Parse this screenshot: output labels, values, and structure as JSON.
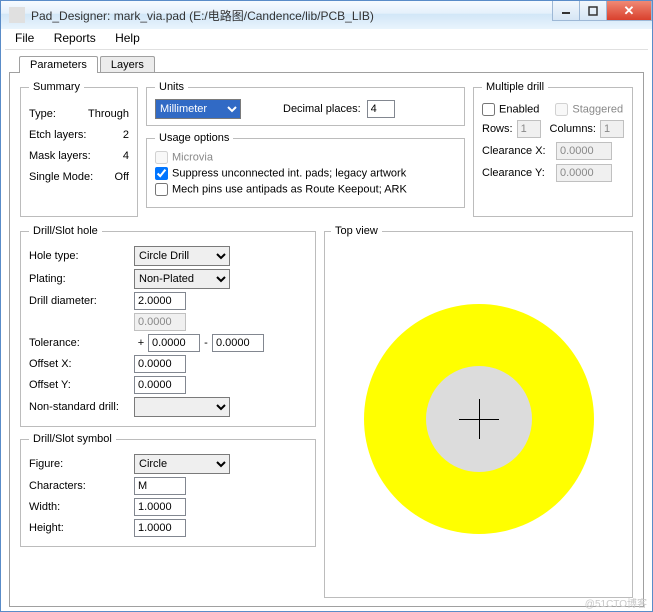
{
  "title": "Pad_Designer: mark_via.pad (E:/电路图/Candence/lib/PCB_LIB)",
  "menu": {
    "file": "File",
    "reports": "Reports",
    "help": "Help"
  },
  "tabs": {
    "parameters": "Parameters",
    "layers": "Layers"
  },
  "summary": {
    "legend": "Summary",
    "type_label": "Type:",
    "type_value": "Through",
    "etch_label": "Etch layers:",
    "etch_value": "2",
    "mask_label": "Mask layers:",
    "mask_value": "4",
    "single_label": "Single Mode:",
    "single_value": "Off"
  },
  "units": {
    "legend": "Units",
    "select_value": "Millimeter",
    "decimal_label": "Decimal places:",
    "decimal_value": "4"
  },
  "usage": {
    "legend": "Usage options",
    "microvia": "Microvia",
    "suppress": "Suppress unconnected int. pads; legacy artwork",
    "mechpins": "Mech pins use antipads as Route Keepout; ARK"
  },
  "mdrill": {
    "legend": "Multiple drill",
    "enabled": "Enabled",
    "staggered": "Staggered",
    "rows_label": "Rows:",
    "rows_value": "1",
    "cols_label": "Columns:",
    "cols_value": "1",
    "clearx_label": "Clearance X:",
    "clearx_value": "0.0000",
    "cleary_label": "Clearance Y:",
    "cleary_value": "0.0000"
  },
  "drillhole": {
    "legend": "Drill/Slot hole",
    "holetype_label": "Hole type:",
    "holetype_value": "Circle Drill",
    "plating_label": "Plating:",
    "plating_value": "Non-Plated",
    "diameter_label": "Drill diameter:",
    "diameter_value": "2.0000",
    "diameter2_value": "0.0000",
    "tol_label": "Tolerance:",
    "tol_plus": "+",
    "tol1": "0.0000",
    "tol_dash": "-",
    "tol2": "0.0000",
    "offx_label": "Offset X:",
    "offx_value": "0.0000",
    "offy_label": "Offset Y:",
    "offy_value": "0.0000",
    "nsd_label": "Non-standard drill:"
  },
  "drillsym": {
    "legend": "Drill/Slot symbol",
    "figure_label": "Figure:",
    "figure_value": "Circle",
    "chars_label": "Characters:",
    "chars_value": "M",
    "width_label": "Width:",
    "width_value": "1.0000",
    "height_label": "Height:",
    "height_value": "1.0000"
  },
  "topview": {
    "legend": "Top view"
  },
  "watermark": "@51CTO博客"
}
